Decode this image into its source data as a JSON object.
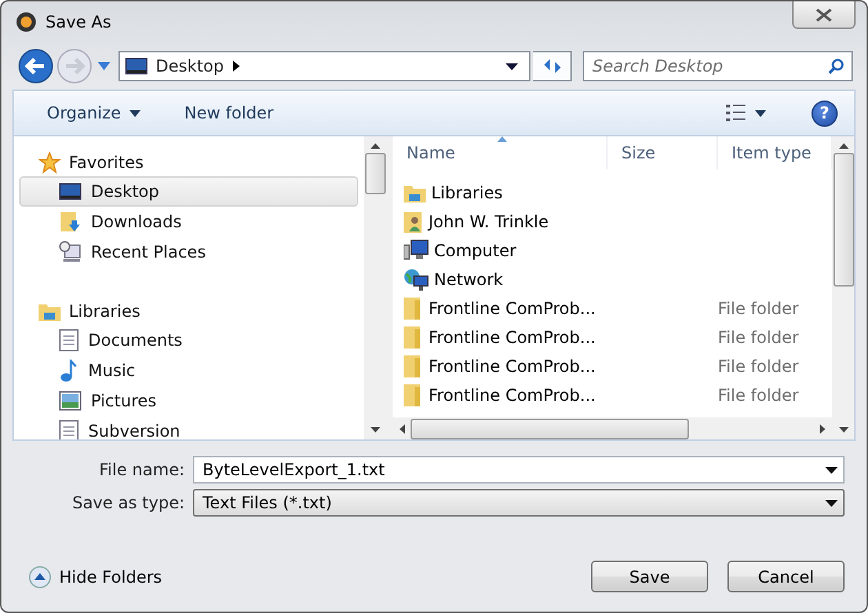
{
  "window": {
    "title": "Save As"
  },
  "address": {
    "location": "Desktop",
    "search_placeholder": "Search Desktop"
  },
  "toolbar": {
    "organize": "Organize",
    "new_folder": "New folder",
    "help": "?"
  },
  "navigation": [
    {
      "label": "Favorites",
      "kind": "star",
      "children": [
        {
          "label": "Desktop",
          "kind": "desktop",
          "selected": true
        },
        {
          "label": "Downloads",
          "kind": "downloads",
          "selected": false
        },
        {
          "label": "Recent Places",
          "kind": "recent",
          "selected": false
        }
      ]
    },
    {
      "label": "Libraries",
      "kind": "library",
      "children": [
        {
          "label": "Documents",
          "kind": "document",
          "selected": false
        },
        {
          "label": "Music",
          "kind": "music",
          "selected": false
        },
        {
          "label": "Pictures",
          "kind": "picture",
          "selected": false
        },
        {
          "label": "Subversion",
          "kind": "document",
          "selected": false
        }
      ]
    }
  ],
  "file_list": {
    "columns": [
      "Name",
      "Size",
      "Item type"
    ],
    "rows": [
      {
        "name": "Libraries",
        "kind": "library"
      },
      {
        "name": "John W. Trinkle",
        "kind": "user"
      },
      {
        "name": "Computer",
        "kind": "computer"
      },
      {
        "name": "Network",
        "kind": "network"
      },
      {
        "name": "Frontline ComProb...",
        "kind": "folder",
        "type": "File folder"
      },
      {
        "name": "Frontline ComProb...",
        "kind": "folder",
        "type": "File folder"
      },
      {
        "name": "Frontline ComProb...",
        "kind": "folder",
        "type": "File folder"
      },
      {
        "name": "Frontline ComProb...",
        "kind": "folder",
        "type": "File folder"
      }
    ]
  },
  "file_name": {
    "label": "File name:",
    "value": "ByteLevelExport_1.txt"
  },
  "save_type": {
    "label": "Save as type:",
    "value": "Text Files (*.txt)"
  },
  "hide_folders": "Hide Folders",
  "buttons": [
    "Save",
    "Cancel"
  ]
}
